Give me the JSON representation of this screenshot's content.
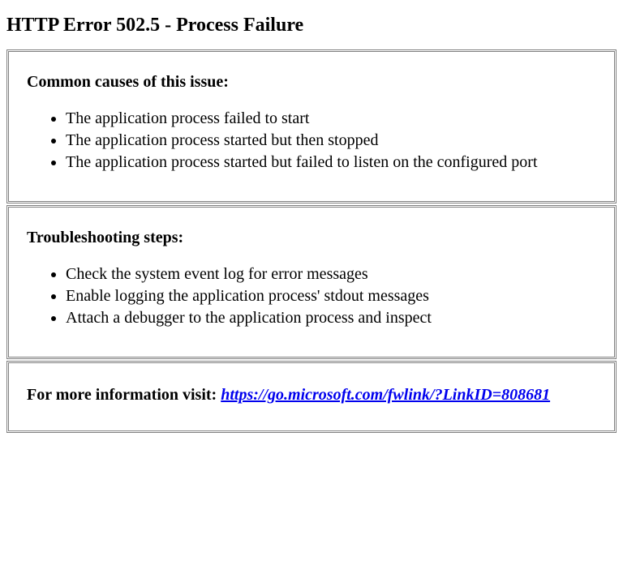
{
  "title": "HTTP Error 502.5 - Process Failure",
  "causes": {
    "heading": "Common causes of this issue:",
    "items": [
      "The application process failed to start",
      "The application process started but then stopped",
      "The application process started but failed to listen on the configured port"
    ]
  },
  "troubleshooting": {
    "heading": "Troubleshooting steps:",
    "items": [
      "Check the system event log for error messages",
      "Enable logging the application process' stdout messages",
      "Attach a debugger to the application process and inspect"
    ]
  },
  "moreinfo": {
    "label": "For more information visit: ",
    "link_text": "https://go.microsoft.com/fwlink/?LinkID=808681",
    "link_href": "https://go.microsoft.com/fwlink/?LinkID=808681"
  }
}
